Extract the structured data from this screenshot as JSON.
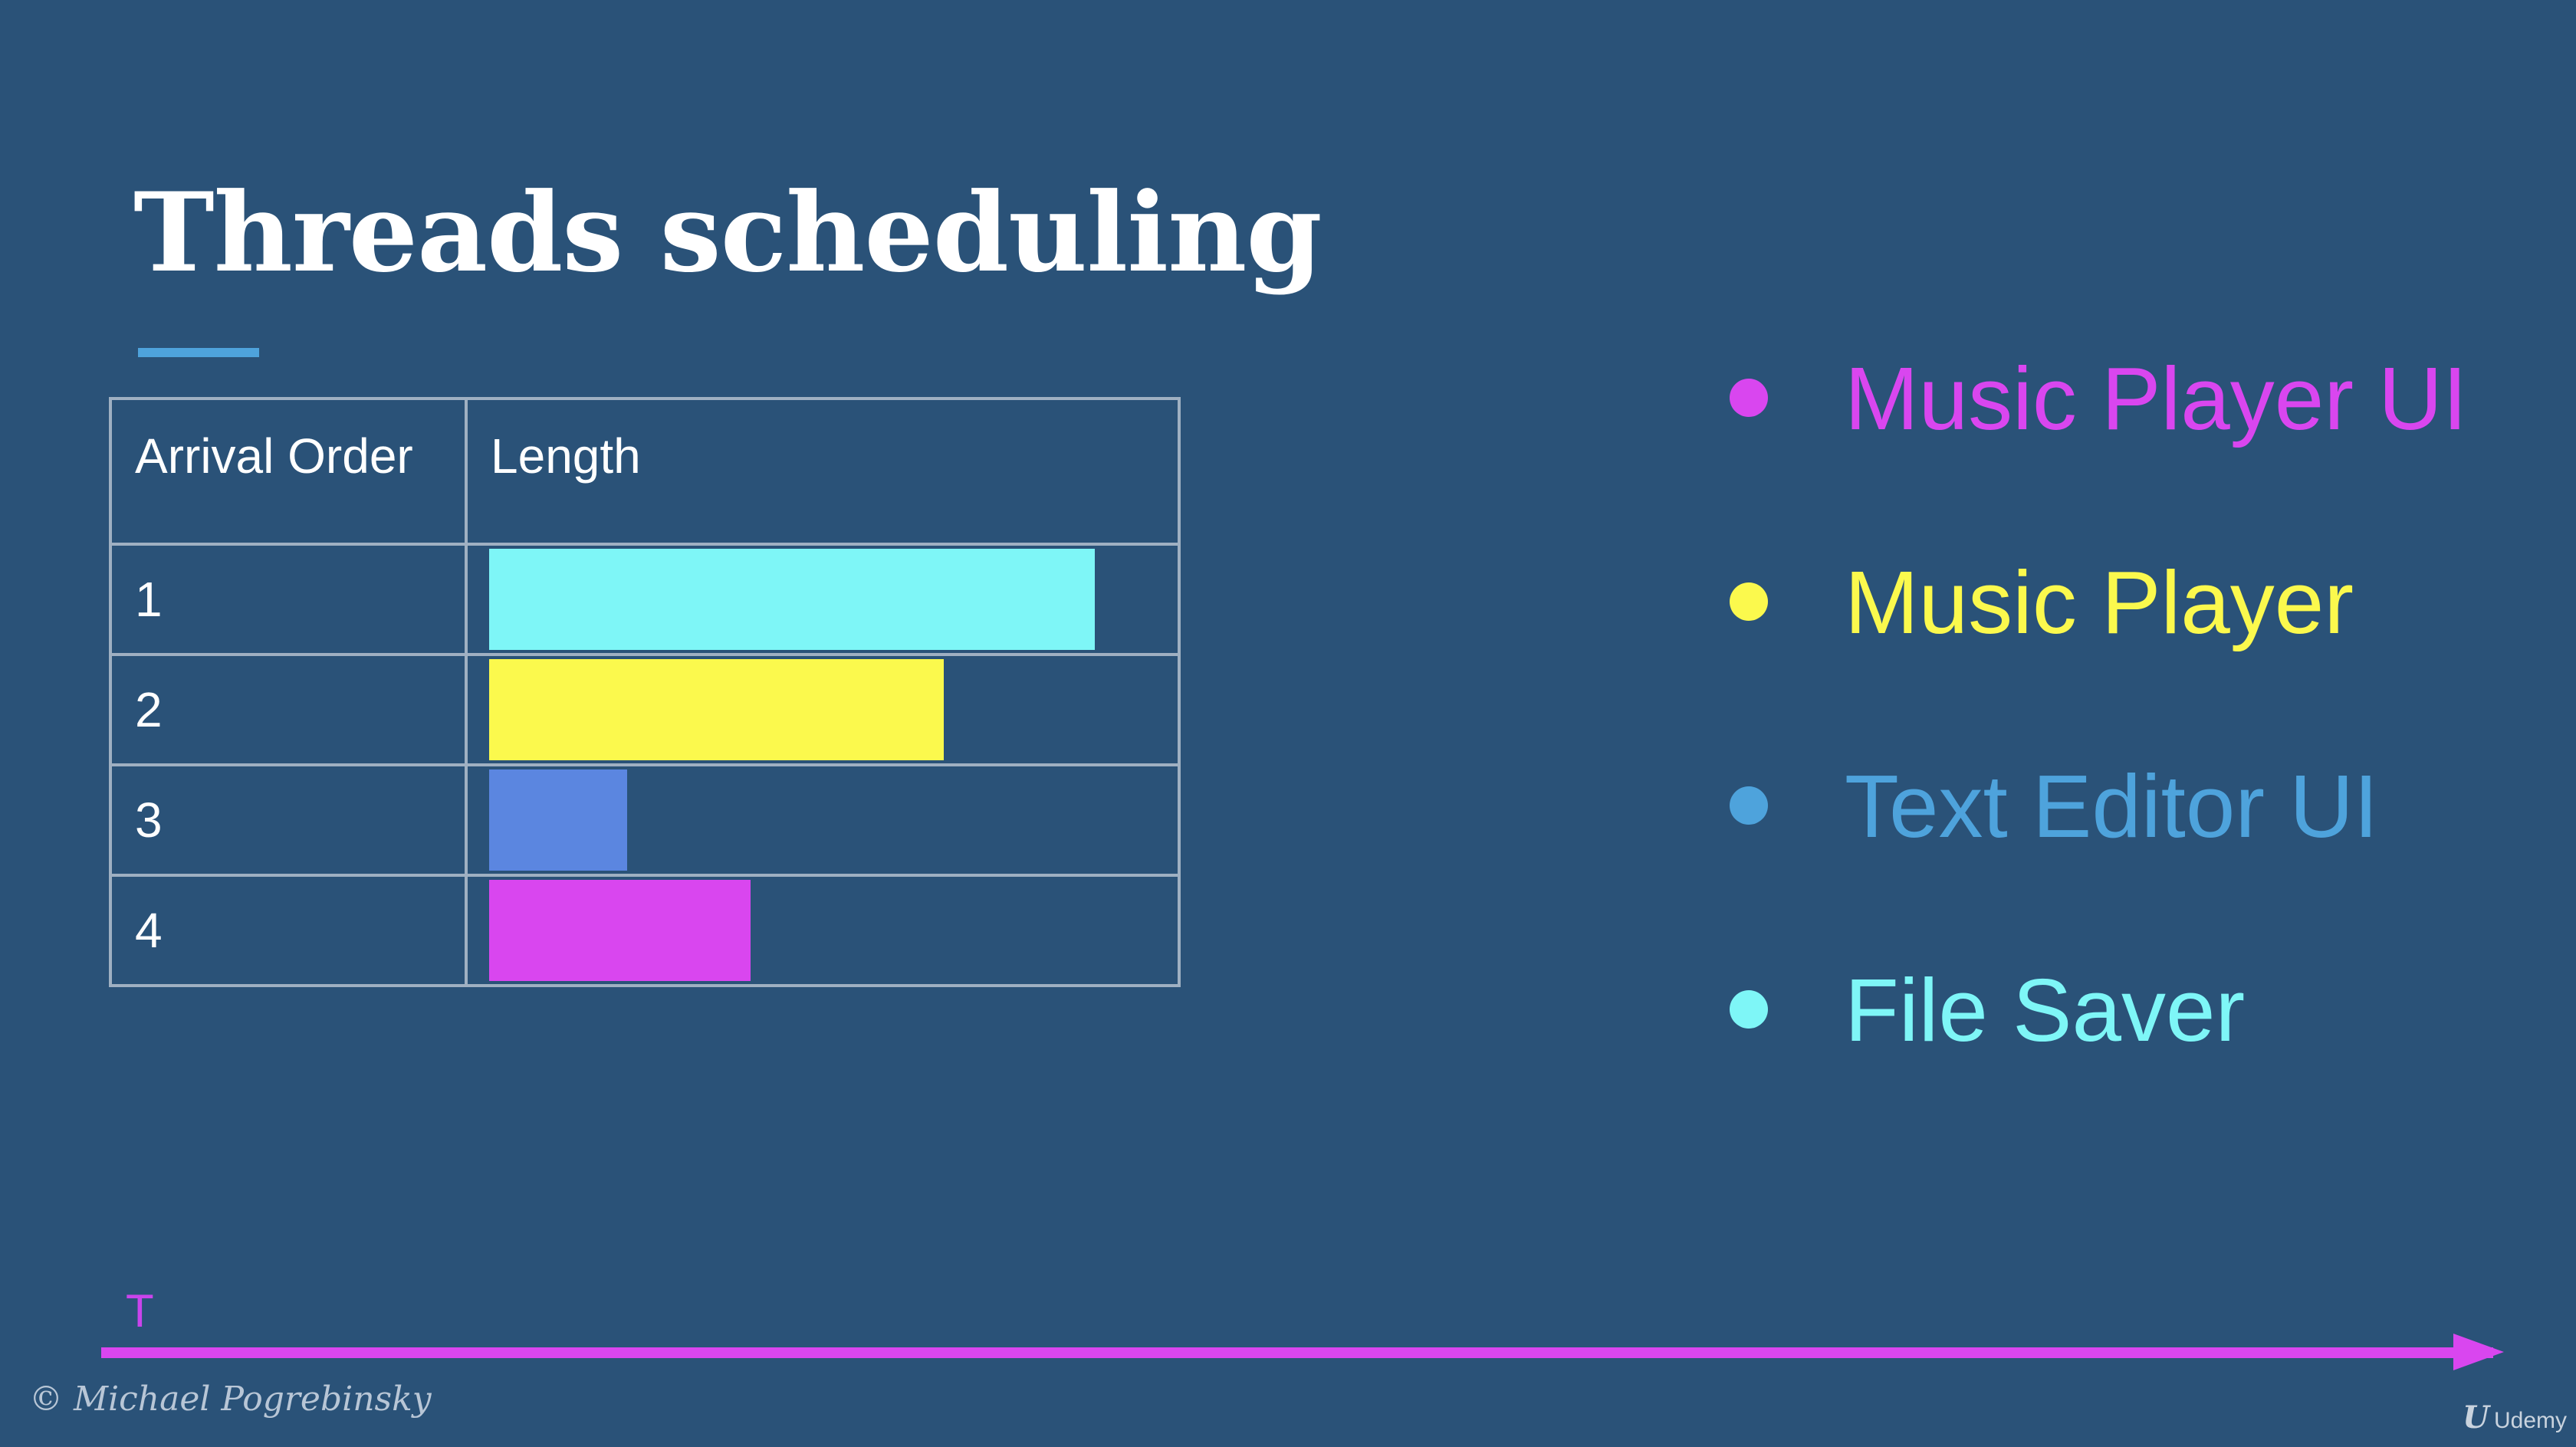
{
  "slide": {
    "title": "Threads scheduling",
    "accent_color": "#4ea3dc"
  },
  "table": {
    "headers": [
      "Arrival Order",
      "Length"
    ],
    "rows": [
      {
        "order": "1",
        "length_fraction": 0.88,
        "color": "#7ef6f7"
      },
      {
        "order": "2",
        "length_fraction": 0.66,
        "color": "#fbf94d"
      },
      {
        "order": "3",
        "length_fraction": 0.2,
        "color": "#5b86e0"
      },
      {
        "order": "4",
        "length_fraction": 0.38,
        "color": "#d946ef"
      }
    ]
  },
  "threads": [
    {
      "label": "Music Player UI",
      "color": "#d946ef"
    },
    {
      "label": "Music Player",
      "color": "#fbf94d"
    },
    {
      "label": "Text Editor UI",
      "color": "#4ea3dc"
    },
    {
      "label": "File Saver",
      "color": "#7ef6f7"
    }
  ],
  "timeline": {
    "label": "T",
    "color": "#d946ef"
  },
  "footer": {
    "copyright": "© Michael Pogrebinsky",
    "brand": "Udemy",
    "brand_mark": "U"
  }
}
